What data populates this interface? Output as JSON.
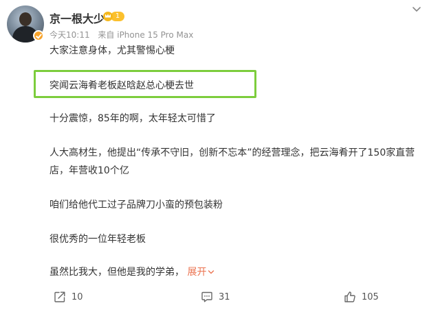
{
  "post": {
    "username": "京一根大少",
    "level": "1",
    "time": "今天10:11",
    "source": "来自 iPhone 15 Pro Max",
    "lines": [
      "大家注意身体，尤其警惕心梗",
      "突闻云海肴老板赵晗赵总心梗去世",
      "十分震惊，85年的啊，太年轻太可惜了",
      "人大高材生，他提出“传承不守旧，创新不忘本”的经营理念，把云海肴开了150家直营",
      "店，年营收10个亿",
      "咱们给他代工过子品牌刀小蛮的预包装粉",
      "很优秀的一位年轻老板",
      "虽然比我大，但他是我的学弟，"
    ],
    "expand_label": "展开"
  },
  "actions": {
    "share_count": "10",
    "comment_count": "31",
    "like_count": "105"
  },
  "colors": {
    "highlight_border": "#7ccd3c",
    "expand": "#eb7350",
    "verified_badge": "#f7a32b",
    "level_badge": "#fbc02d",
    "meta_text": "#939393"
  },
  "icons": {
    "menu": "chevron-down-icon",
    "share": "share-icon",
    "comment": "comment-icon",
    "like": "thumbs-up-icon",
    "verified": "verified-badge-icon",
    "level": "crown-icon"
  }
}
